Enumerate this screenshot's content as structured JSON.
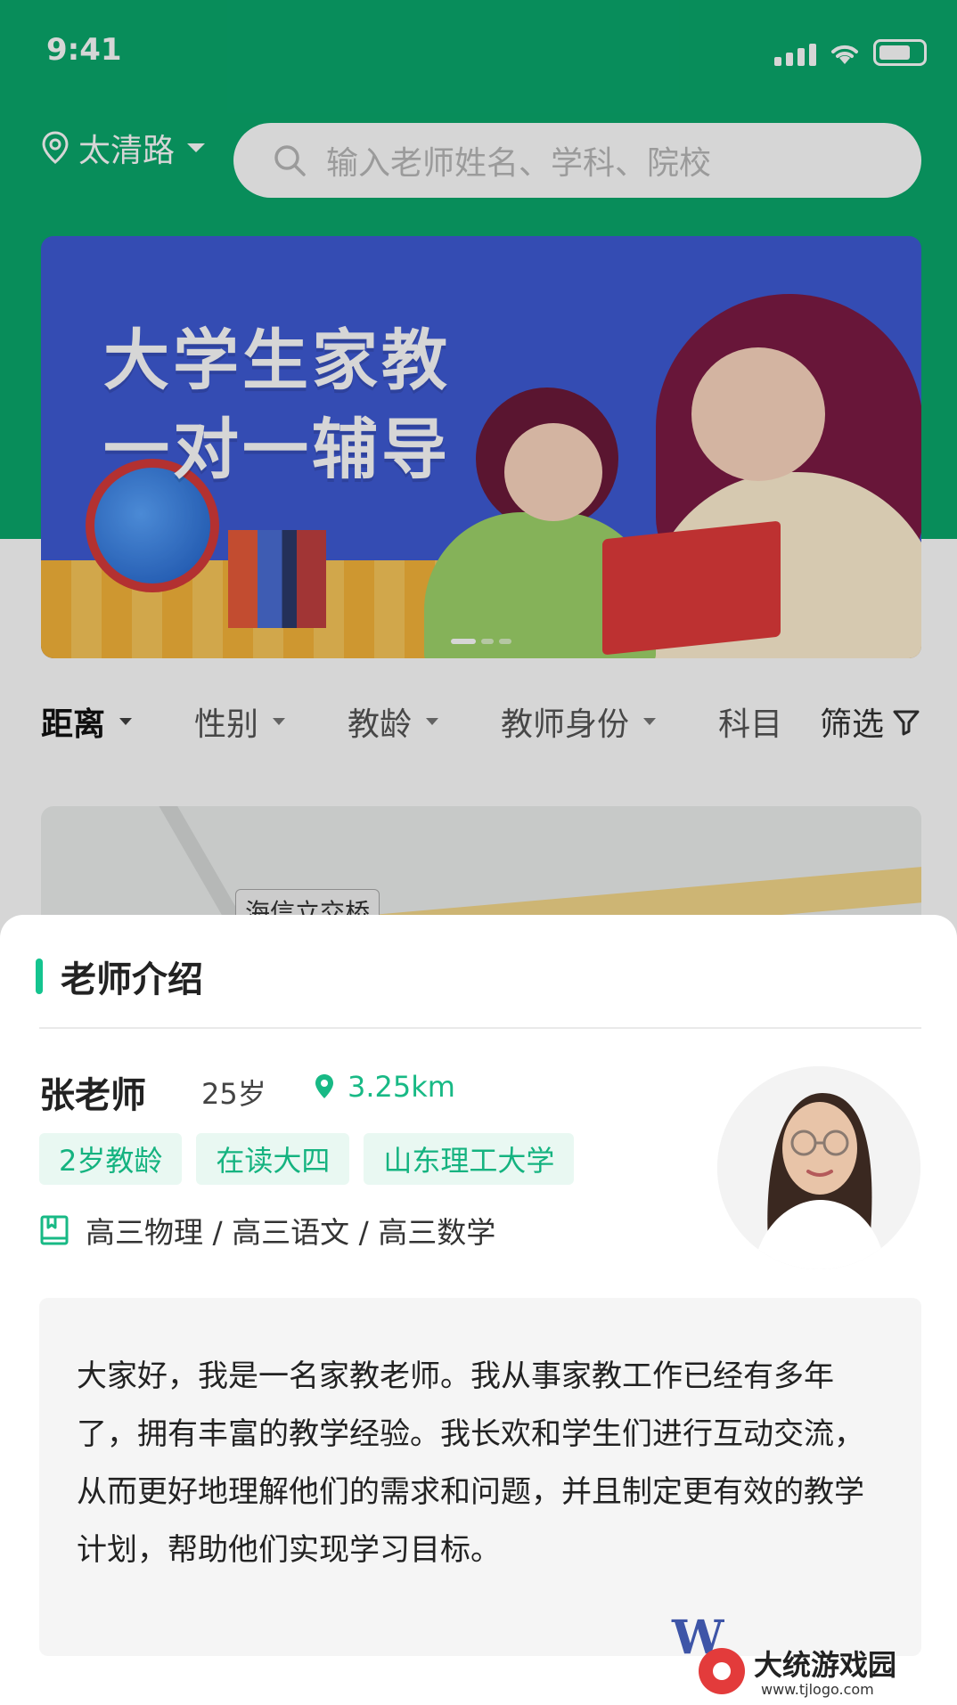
{
  "status_bar": {
    "time": "9:41"
  },
  "header": {
    "location": "太清路",
    "search_placeholder": "输入老师姓名、学科、院校"
  },
  "banner": {
    "line1": "大学生家教",
    "line2": "一对一辅导"
  },
  "filters": {
    "items": [
      "距离",
      "性别",
      "教龄",
      "教师身份",
      "科目"
    ],
    "active_index": 0,
    "filter_button": "筛选"
  },
  "map": {
    "label": "海信立交桥"
  },
  "sheet": {
    "title": "老师介绍",
    "teacher": {
      "name": "张老师",
      "age": "25岁",
      "distance": "3.25km",
      "tags": [
        "2岁教龄",
        "在读大四",
        "山东理工大学"
      ],
      "subjects": "高三物理 / 高三语文 / 高三数学",
      "bio": "大家好，我是一名家教老师。我从事家教工作已经有多年了，拥有丰富的教学经验。我长欢和学生们进行互动交流，从而更好地理解他们的需求和问题，并且制定更有效的教学计划，帮助他们实现学习目标。"
    }
  },
  "watermark": {
    "brand": "大统游戏园",
    "url": "www.tjlogo.com"
  },
  "colors": {
    "primary": "#0aa86c",
    "accent": "#14c48f",
    "tag_bg": "#e9f8f2"
  },
  "icons": [
    "location-pin-icon",
    "search-icon",
    "filter-funnel-icon",
    "book-icon",
    "distance-pin-icon",
    "wifi-icon",
    "signal-icon",
    "battery-icon"
  ]
}
